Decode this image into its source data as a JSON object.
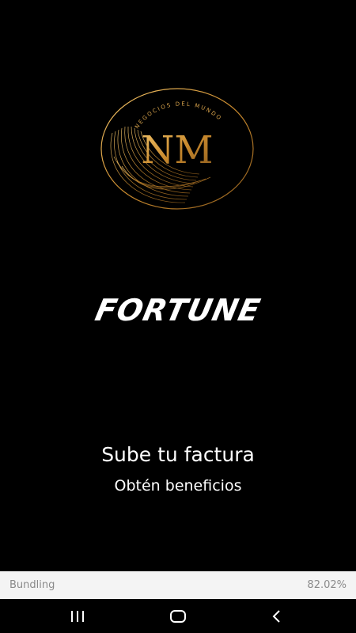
{
  "logo": {
    "initials": "NM",
    "arc_text": "NEGOCIOS DEL MUNDO",
    "accent_color": "#d4a04a"
  },
  "brand": {
    "name": "FORTUNE"
  },
  "content": {
    "headline": "Sube tu factura",
    "subline": "Obtén beneficios"
  },
  "bundling": {
    "label": "Bundling",
    "progress": "82.02%"
  },
  "navbar": {
    "recent_icon": "recent-apps-icon",
    "home_icon": "home-icon",
    "back_icon": "back-icon"
  }
}
